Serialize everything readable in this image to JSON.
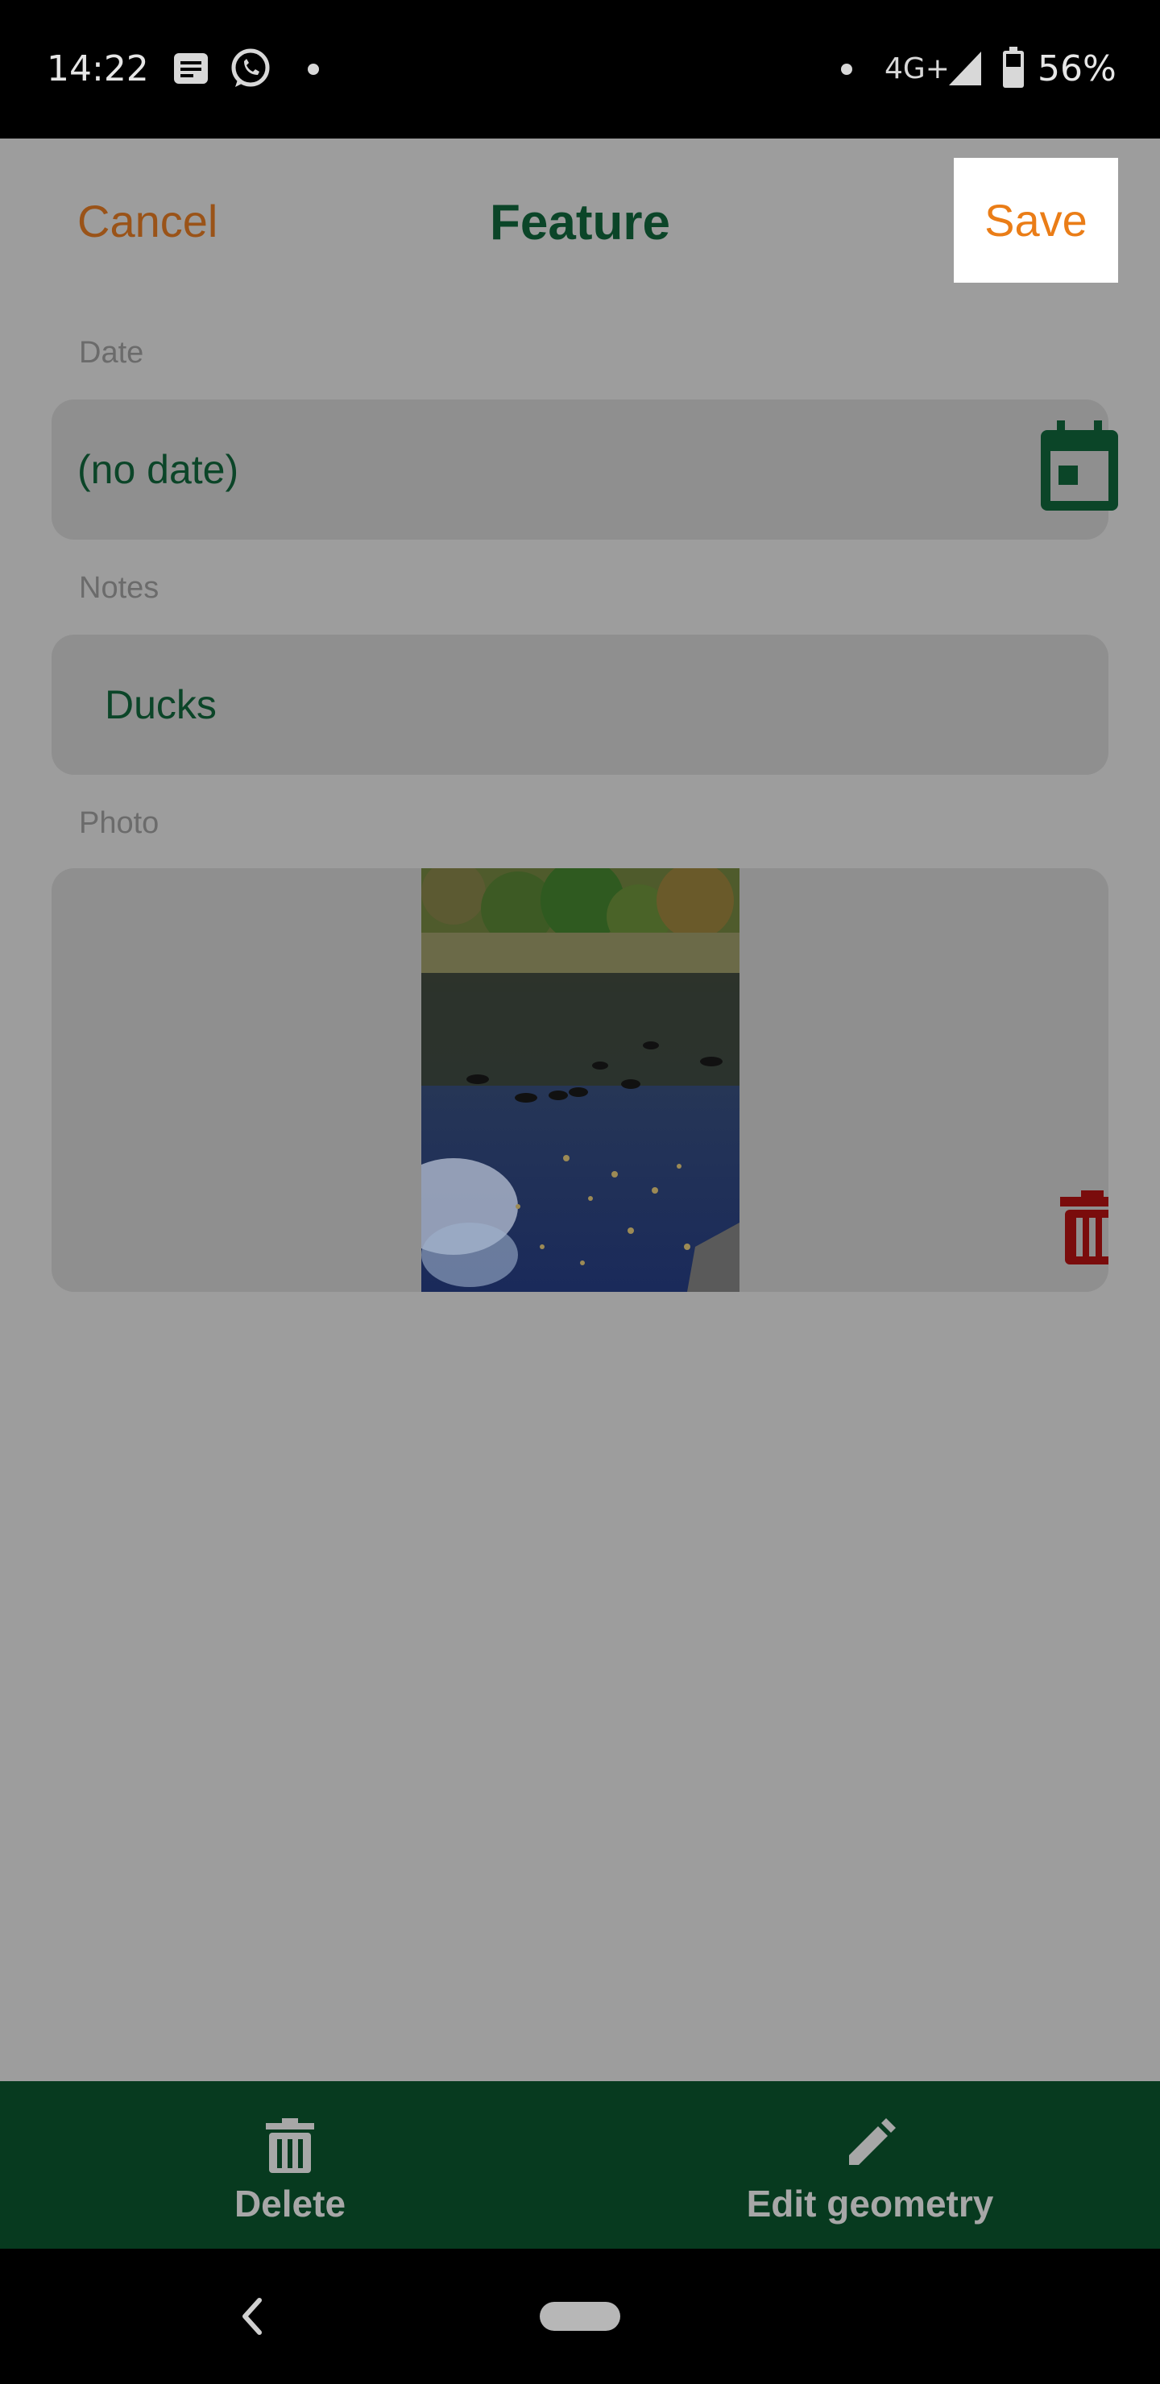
{
  "status_bar": {
    "time": "14:22",
    "network": "4G+",
    "battery": "56%",
    "icons": [
      "news-icon",
      "whatsapp-icon",
      "notification-dot-icon",
      "signal-icon",
      "battery-icon"
    ]
  },
  "header": {
    "cancel_label": "Cancel",
    "title": "Feature",
    "save_label": "Save"
  },
  "form": {
    "date": {
      "label": "Date",
      "value": "(no date)",
      "icon": "calendar-icon"
    },
    "notes": {
      "label": "Notes",
      "value": "Ducks"
    },
    "photo": {
      "label": "Photo",
      "delete_icon": "trash-icon"
    }
  },
  "actions": {
    "delete_label": "Delete",
    "edit_geometry_label": "Edit geometry"
  },
  "colors": {
    "accent_orange": "#ea7d17",
    "cancel_orange": "#9a5318",
    "brand_green": "#0b4528",
    "action_bar_green": "#073a1f",
    "delete_red": "#7a0c0c",
    "overlay_gray": "#9d9d9d"
  }
}
